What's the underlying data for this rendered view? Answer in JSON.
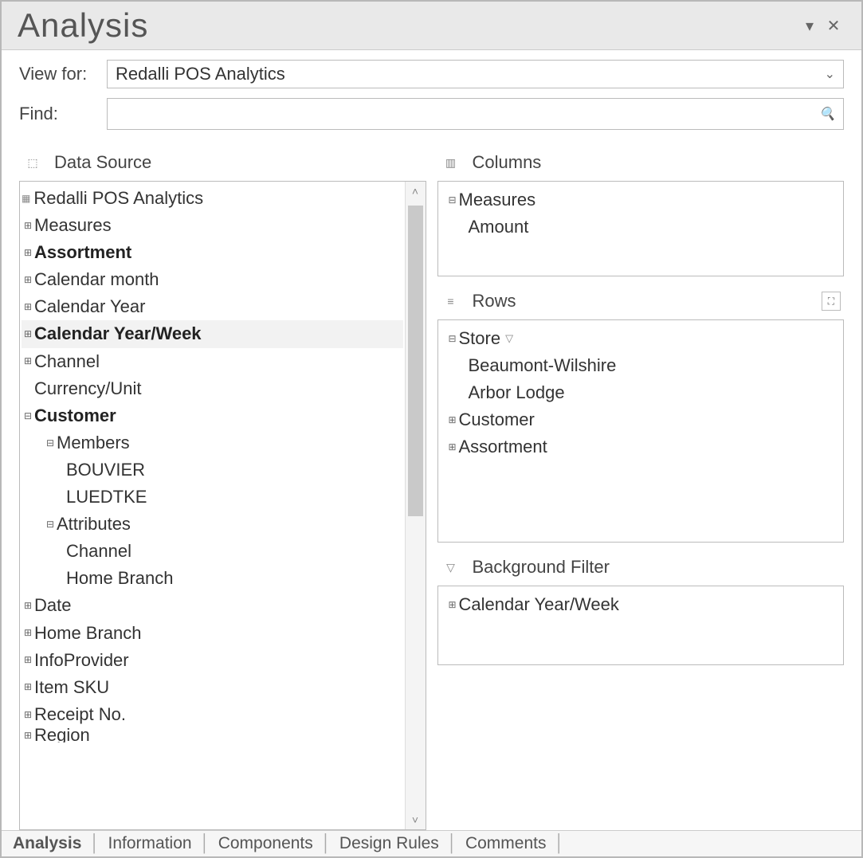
{
  "title": "Analysis",
  "top": {
    "view_for_label": "View for:",
    "view_for_value": "Redalli POS Analytics",
    "find_label": "Find:",
    "find_value": ""
  },
  "sections": {
    "data_source": "Data Source",
    "columns": "Columns",
    "rows": "Rows",
    "bg_filter": "Background Filter"
  },
  "data_source_tree": {
    "root": "Redalli POS Analytics",
    "measures": "Measures",
    "assortment": "Assortment",
    "cal_month": "Calendar month",
    "cal_year": "Calendar Year",
    "cal_year_week": "Calendar Year/Week",
    "channel": "Channel",
    "currency_unit": "Currency/Unit",
    "customer": "Customer",
    "customer_members": "Members",
    "customer_members_b": "BOUVIER",
    "customer_members_l": "LUEDTKE",
    "customer_attrs": "Attributes",
    "customer_attrs_channel": "Channel",
    "customer_attrs_hb": "Home Branch",
    "date": "Date",
    "home_branch": "Home Branch",
    "info_provider": "InfoProvider",
    "item_sku": "Item SKU",
    "receipt_no": "Receipt No.",
    "region": "Region"
  },
  "columns_tree": {
    "measures": "Measures",
    "amount": "Amount"
  },
  "rows_tree": {
    "store": "Store",
    "store_bw": "Beaumont-Wilshire",
    "store_al": "Arbor Lodge",
    "customer": "Customer",
    "assortment": "Assortment"
  },
  "bg_filter": {
    "cal_year_week": "Calendar Year/Week"
  },
  "tabs": {
    "analysis": "Analysis",
    "information": "Information",
    "components": "Components",
    "design_rules": "Design Rules",
    "comments": "Comments"
  }
}
